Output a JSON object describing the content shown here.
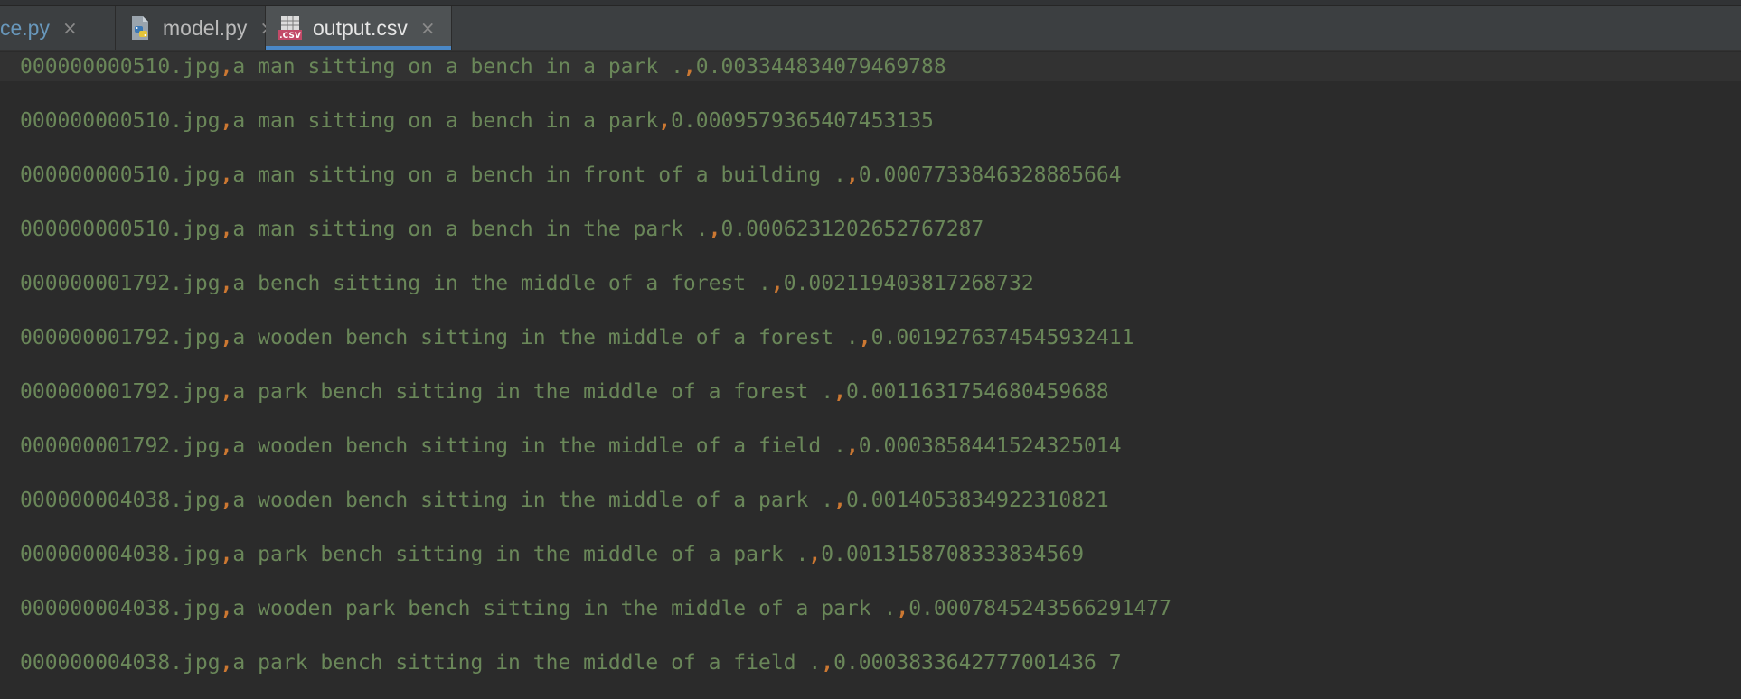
{
  "tabs": [
    {
      "label": "ce.py",
      "close": "×",
      "icon": "python-file-icon"
    },
    {
      "label": "model.py",
      "close": "×",
      "icon": "python-file-icon"
    },
    {
      "label": "output.csv",
      "close": "×",
      "icon": "csv-file-icon",
      "active": true
    }
  ],
  "csv_badge": ".CSV",
  "separator": ",",
  "rows": [
    {
      "file": "000000000510.jpg",
      "caption": "a man sitting on a bench in a park .",
      "score": "0.003344834079469788"
    },
    {
      "file": "000000000510.jpg",
      "caption": "a man sitting on a bench in a park",
      "score": "0.0009579365407453135"
    },
    {
      "file": "000000000510.jpg",
      "caption": "a man sitting on a bench in front of a building .",
      "score": "0.0007733846328885664"
    },
    {
      "file": "000000000510.jpg",
      "caption": "a man sitting on a bench in the park .",
      "score": "0.0006231202652767287"
    },
    {
      "file": "000000001792.jpg",
      "caption": "a bench sitting in the middle of a forest .",
      "score": "0.002119403817268732"
    },
    {
      "file": "000000001792.jpg",
      "caption": "a wooden bench sitting in the middle of a forest .",
      "score": "0.0019276374545932411"
    },
    {
      "file": "000000001792.jpg",
      "caption": "a park bench sitting in the middle of a forest .",
      "score": "0.0011631754680459688"
    },
    {
      "file": "000000001792.jpg",
      "caption": "a wooden bench sitting in the middle of a field .",
      "score": "0.0003858441524325014"
    },
    {
      "file": "000000004038.jpg",
      "caption": "a wooden bench sitting in the middle of a park .",
      "score": "0.0014053834922310821"
    },
    {
      "file": "000000004038.jpg",
      "caption": "a park bench sitting in the middle of a park .",
      "score": "0.0013158708333834569"
    },
    {
      "file": "000000004038.jpg",
      "caption": "a wooden park bench sitting in the middle of a park .",
      "score": "0.0007845243566291477"
    },
    {
      "file": "000000004038.jpg",
      "caption": "a park bench sitting in the middle of a field .",
      "score": "0.0003833642777001436 7"
    }
  ],
  "colors": {
    "background": "#2b2b2b",
    "tabbar": "#3c3f41",
    "active_tab": "#4e5254",
    "active_underline": "#4a88c7",
    "text_green": "#6a8759",
    "comma_orange": "#cc7832"
  }
}
